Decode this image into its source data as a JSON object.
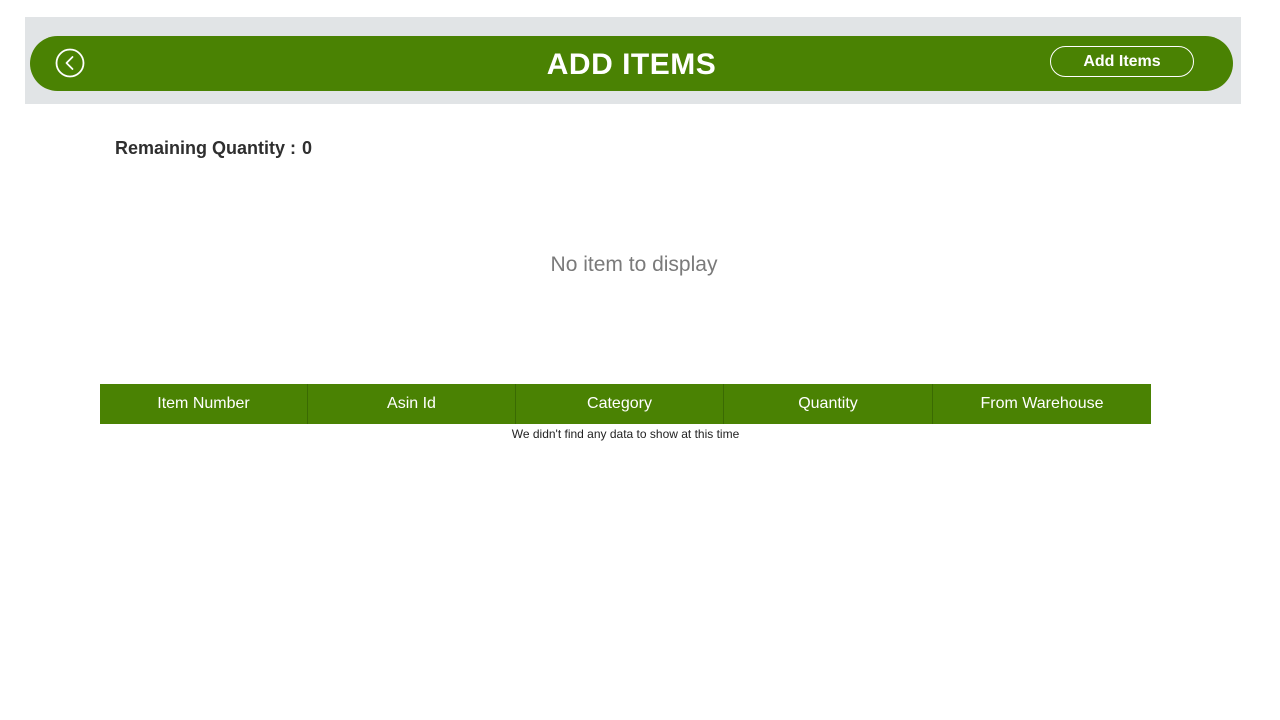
{
  "header": {
    "title": "ADD ITEMS",
    "add_items_label": "Add Items",
    "back_icon": "chevron-left-circle-icon",
    "bar_color": "#4a8203",
    "band_color": "#e1e4e6"
  },
  "summary": {
    "remaining_label": "Remaining Quantity :",
    "remaining_value": "0"
  },
  "gallery": {
    "empty_message": "No item to display"
  },
  "grid": {
    "columns": [
      "Item Number",
      "Asin Id",
      "Category",
      "Quantity",
      "From Warehouse"
    ],
    "empty_message": "We didn't find any data to show at this time",
    "header_color": "#4a8203"
  }
}
